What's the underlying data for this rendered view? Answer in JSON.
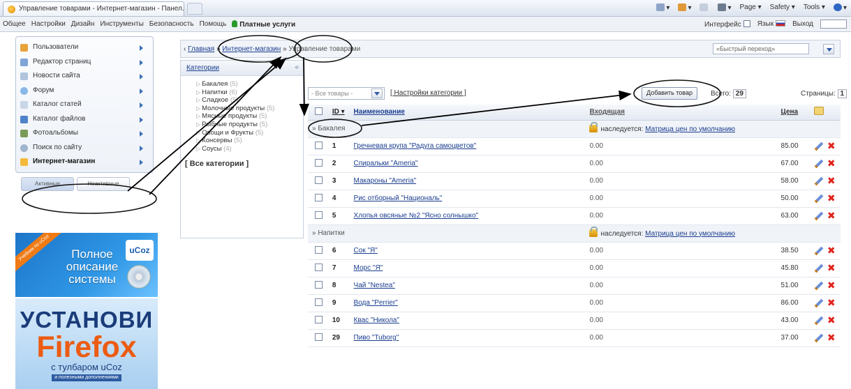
{
  "browser": {
    "tab_title": "Управление товарами - Интернет-магазин - Панел...",
    "tools": [
      "Page ▾",
      "Safety ▾",
      "Tools ▾"
    ]
  },
  "topmenu": {
    "items": [
      "Общее",
      "Настройки",
      "Дизайн",
      "Инструменты",
      "Безопасность",
      "Помощь"
    ],
    "paid": "Платные услуги",
    "interface_label": "Интерфейс",
    "lang_label": "Язык",
    "exit_label": "Выход"
  },
  "sidebar": {
    "items": [
      {
        "label": "Пользователи",
        "icon": "users-icon",
        "color": "#e8a33a"
      },
      {
        "label": "Редактор страниц",
        "icon": "page-editor-icon",
        "color": "#7fa5d8"
      },
      {
        "label": "Новости сайта",
        "icon": "news-icon",
        "color": "#b0c4de"
      },
      {
        "label": "Форум",
        "icon": "forum-icon",
        "color": "#8ab8e8"
      },
      {
        "label": "Каталог статей",
        "icon": "articles-icon",
        "color": "#c8d6e8"
      },
      {
        "label": "Каталог файлов",
        "icon": "files-icon",
        "color": "#4f82c8"
      },
      {
        "label": "Фотоальбомы",
        "icon": "photo-icon",
        "color": "#7a9a5a"
      },
      {
        "label": "Поиск по сайту",
        "icon": "search-icon",
        "color": "#a0b4cc"
      },
      {
        "label": "Интернет-магазин",
        "icon": "shop-icon",
        "color": "#f2b93b"
      }
    ],
    "tab_active": "Активные",
    "tab_inactive": "Неактивные"
  },
  "banner1": {
    "ribbon": "Учебник по uCoz",
    "line1": "Полное",
    "line2": "описание",
    "line3": "системы",
    "logo": "uCoz"
  },
  "banner2": {
    "line1": "УСТАНОВИ",
    "line2": "Firefox",
    "line3": "с тулбаром uCoz",
    "line4": "и полезными дополнениями"
  },
  "breadcrumb": {
    "home": "Главная",
    "shop": "Интернет-магазин",
    "current": "Управление товарами",
    "quick_nav": "«Быстрый переход»"
  },
  "categories": {
    "title": "Категории",
    "items": [
      {
        "name": "Бакалея",
        "count": "(5)"
      },
      {
        "name": "Напитки",
        "count": "(6)"
      },
      {
        "name": "Сладкое",
        "count": "(5)"
      },
      {
        "name": "Молочные продукты",
        "count": "(5)"
      },
      {
        "name": "Мясные продукты",
        "count": "(5)"
      },
      {
        "name": "Рыбные продукты",
        "count": "(5)"
      },
      {
        "name": "Овощи и Фрукты",
        "count": "(5)"
      },
      {
        "name": "Консервы",
        "count": "(5)"
      },
      {
        "name": "Соусы",
        "count": "(4)"
      }
    ],
    "all_label": "[ Все категории ]"
  },
  "toolbar": {
    "filter_value": "- Все товары -",
    "cat_settings": "[ Настройки категории ]",
    "add_button": "Добавить товар",
    "total_label": "Всего:",
    "total_value": "29",
    "pages_label": "Страницы:",
    "pages_value": "1"
  },
  "table": {
    "columns": {
      "id": "ID",
      "name": "Наименование",
      "incoming": "Входящая",
      "price": "Цена"
    },
    "inherit_label": "наследуется:",
    "inherit_link": "Матрица цен по умолчанию",
    "groups": [
      {
        "name": "» Бакалея",
        "rows": [
          {
            "id": "1",
            "name": "Гречневая крупа \"Радуга самоцветов\"",
            "incoming": "0.00",
            "price": "85.00"
          },
          {
            "id": "2",
            "name": "Спиральки \"Ameria\"",
            "incoming": "0.00",
            "price": "67.00"
          },
          {
            "id": "3",
            "name": "Макароны \"Ameria\"",
            "incoming": "0.00",
            "price": "58.00"
          },
          {
            "id": "4",
            "name": "Рис отборный \"Националь\"",
            "incoming": "0.00",
            "price": "50.00"
          },
          {
            "id": "5",
            "name": "Хлопья овсяные №2 \"Ясно солнышко\"",
            "incoming": "0.00",
            "price": "63.00"
          }
        ]
      },
      {
        "name": "» Напитки",
        "rows": [
          {
            "id": "6",
            "name": "Сок \"Я\"",
            "incoming": "0.00",
            "price": "38.50"
          },
          {
            "id": "7",
            "name": "Морс \"Я\"",
            "incoming": "0.00",
            "price": "45.80"
          },
          {
            "id": "8",
            "name": "Чай \"Nestea\"",
            "incoming": "0.00",
            "price": "51.00"
          },
          {
            "id": "9",
            "name": "Вода \"Perrier\"",
            "incoming": "0.00",
            "price": "86.00"
          },
          {
            "id": "10",
            "name": "Квас \"Никола\"",
            "incoming": "0.00",
            "price": "43.00"
          },
          {
            "id": "29",
            "name": "Пиво \"Tuborg\"",
            "incoming": "0.00",
            "price": "37.00"
          }
        ]
      }
    ]
  }
}
